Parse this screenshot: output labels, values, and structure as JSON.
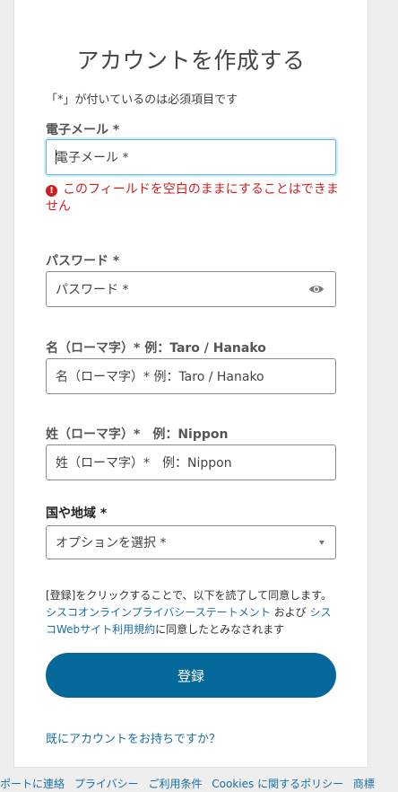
{
  "form": {
    "title": "アカウントを作成する",
    "required_note": "「*」が付いているのは必須項目です",
    "email": {
      "label": "電子メール *",
      "placeholder": "電子メール *",
      "error": "このフィールドを空白のままにすることはできません"
    },
    "password": {
      "label": "パスワード *",
      "placeholder": "パスワード *"
    },
    "first_name": {
      "label": "名（ローマ字）* 例：Taro / Hanako",
      "placeholder": "名（ローマ字）* 例：Taro / Hanako"
    },
    "last_name": {
      "label": "姓（ローマ字）*　例：Nippon",
      "placeholder": "姓（ローマ字）*　例：Nippon"
    },
    "country": {
      "label": "国や地域 *",
      "selected": "オプションを選択 *"
    },
    "terms": {
      "prefix": "[登録]をクリックすることで、以下を読了して同意します。",
      "privacy_link": "シスコオンラインプライバシーステートメント",
      "and": " および ",
      "web_terms_link": "シスコWebサイト利用規約",
      "suffix": "に同意したとみなされます"
    },
    "register_button": "登録",
    "signin_link": "既にアカウントをお持ちですか？"
  },
  "footer": {
    "links": [
      "ポートに連絡",
      "プライバシー",
      "ご利用条件",
      "Cookies に関するポリシー",
      "商標"
    ]
  },
  "colors": {
    "accent": "#04699a",
    "link": "#1a6fa3",
    "error": "#cc1f1f",
    "focus": "#62b6dc"
  },
  "icons": {
    "error": "error-circle-icon",
    "password_toggle": "eye-icon",
    "select": "caret-down-icon"
  }
}
